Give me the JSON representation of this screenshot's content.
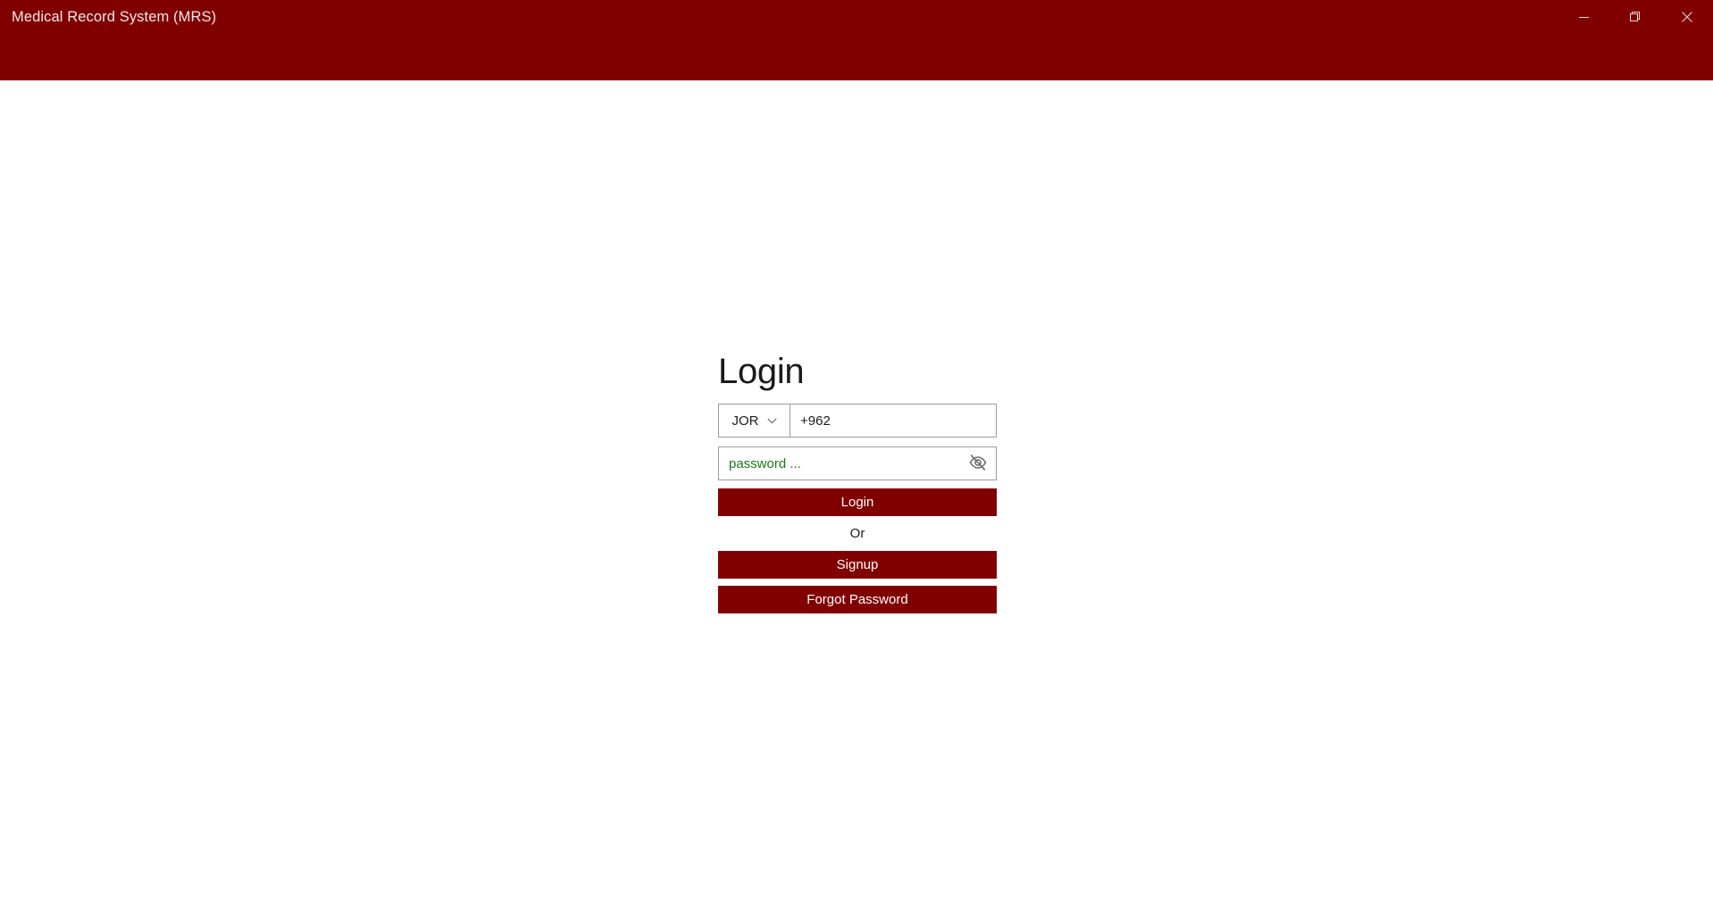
{
  "window": {
    "title": "Medical Record System (MRS)",
    "controls": [
      {
        "name": "minimize-button",
        "icon": "minimize-icon",
        "label": "Minimize"
      },
      {
        "name": "restore-button",
        "icon": "restore-icon",
        "label": "Restore"
      },
      {
        "name": "close-button",
        "icon": "close-icon",
        "label": "Close"
      }
    ]
  },
  "colors": {
    "brand_maroon": "#800000",
    "titlebar_text": "#f2e6e6",
    "page_background": "#ffffff",
    "field_border": "#9b9b9b",
    "placeholder_green": "#1b7a1b",
    "body_text": "#1b1b1b",
    "button_text": "#ffffff"
  },
  "login": {
    "heading": "Login",
    "country": {
      "selected": "JOR",
      "icon": "chevron-down-icon"
    },
    "phone": {
      "value": "+962",
      "placeholder": "+962"
    },
    "password": {
      "value": "",
      "placeholder": "password ...",
      "toggle_icon": "eye-slash-icon"
    },
    "login_button": "Login",
    "or_text": "Or",
    "signup_button": "Signup",
    "forgot_password_button": "Forgot Password"
  }
}
